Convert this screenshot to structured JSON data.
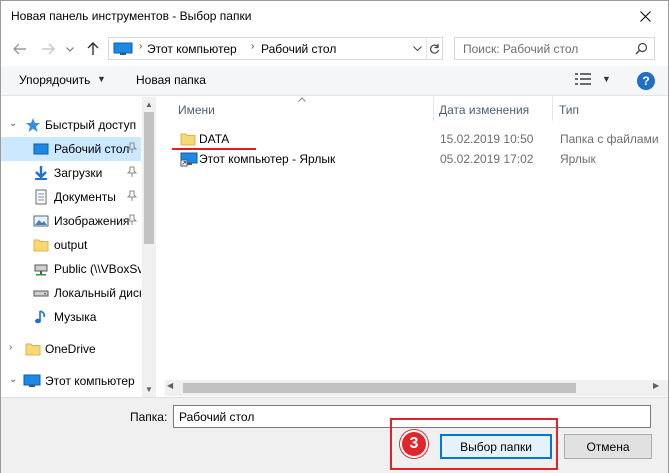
{
  "window": {
    "title": "Новая панель инструментов - Выбор папки"
  },
  "address": {
    "crumbs": [
      "Этот компьютер",
      "Рабочий стол"
    ],
    "search_placeholder": "Поиск: Рабочий стол"
  },
  "toolbar": {
    "organize_label": "Упорядочить",
    "new_folder_label": "Новая папка",
    "help_label": "?"
  },
  "sidebar": {
    "items": [
      {
        "label": "Быстрый доступ",
        "icon": "star-icon",
        "pinned": false
      },
      {
        "label": "Рабочий стол",
        "icon": "desktop-icon",
        "pinned": true
      },
      {
        "label": "Загрузки",
        "icon": "download-icon",
        "pinned": true
      },
      {
        "label": "Документы",
        "icon": "documents-icon",
        "pinned": true
      },
      {
        "label": "Изображения",
        "icon": "pictures-icon",
        "pinned": true
      },
      {
        "label": "output",
        "icon": "folder-icon",
        "pinned": false
      },
      {
        "label": "Public (\\\\VBoxSvr)",
        "icon": "network-drive-icon",
        "pinned": false
      },
      {
        "label": "Локальный диск",
        "icon": "drive-icon",
        "pinned": false
      },
      {
        "label": "Музыка",
        "icon": "music-icon",
        "pinned": false
      },
      {
        "label": "OneDrive",
        "icon": "folder-icon",
        "pinned": false
      },
      {
        "label": "Этот компьютер",
        "icon": "computer-icon",
        "pinned": false
      }
    ]
  },
  "filelist": {
    "columns": [
      "Имени",
      "Дата изменения",
      "Тип"
    ],
    "rows": [
      {
        "name": "DATA",
        "date": "15.02.2019 10:50",
        "type": "Папка с файлами",
        "icon": "folder-icon"
      },
      {
        "name": "Этот компьютер - Ярлык",
        "date": "05.02.2019 17:02",
        "type": "Ярлык",
        "icon": "shortcut-icon"
      }
    ]
  },
  "bottom": {
    "folder_label": "Папка:",
    "folder_value": "Рабочий стол",
    "select_button": "Выбор папки",
    "cancel_button": "Отмена",
    "step_badge": "3"
  },
  "colors": {
    "accent": "#0078d7",
    "selection": "#cce8ff",
    "annotation_red": "#d9262b"
  }
}
